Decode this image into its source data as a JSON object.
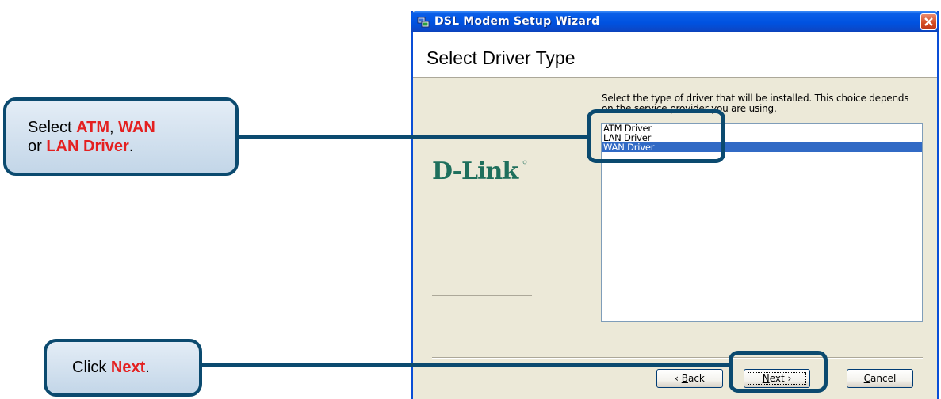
{
  "window": {
    "title": "DSL Modem Setup Wizard",
    "header_title": "Select Driver Type",
    "logo_text": "D-Link",
    "instructions": "Select the type of driver that will be installed.  This choice depends on the service provider you are using.",
    "drivers": [
      {
        "label": "ATM Driver",
        "selected": false
      },
      {
        "label": "LAN Driver",
        "selected": false
      },
      {
        "label": "WAN Driver",
        "selected": true
      }
    ],
    "buttons": {
      "back_label": "Back",
      "back_mnemonic": "B",
      "back_rest": "ack",
      "next_label": "Next",
      "next_mnemonic": "N",
      "next_rest": "ext",
      "cancel_label": "Cancel",
      "cancel_mnemonic": "C",
      "cancel_rest": "ancel"
    }
  },
  "callouts": {
    "select_driver": {
      "prefix": "Select ",
      "atm": "ATM",
      "sep1": ", ",
      "wan": "WAN",
      "line2_prefix": "or ",
      "lan": "LAN Driver",
      "suffix": "."
    },
    "click_next": {
      "prefix": "Click ",
      "next": "Next",
      "suffix": "."
    }
  },
  "colors": {
    "titlebar": "#0052e0",
    "callout_border": "#0b4a6f",
    "emphasis": "#e42020",
    "selection": "#316ac5",
    "logo_green": "#1e6f5c"
  },
  "icons": [
    "setup-wizard-icon",
    "close-icon"
  ]
}
